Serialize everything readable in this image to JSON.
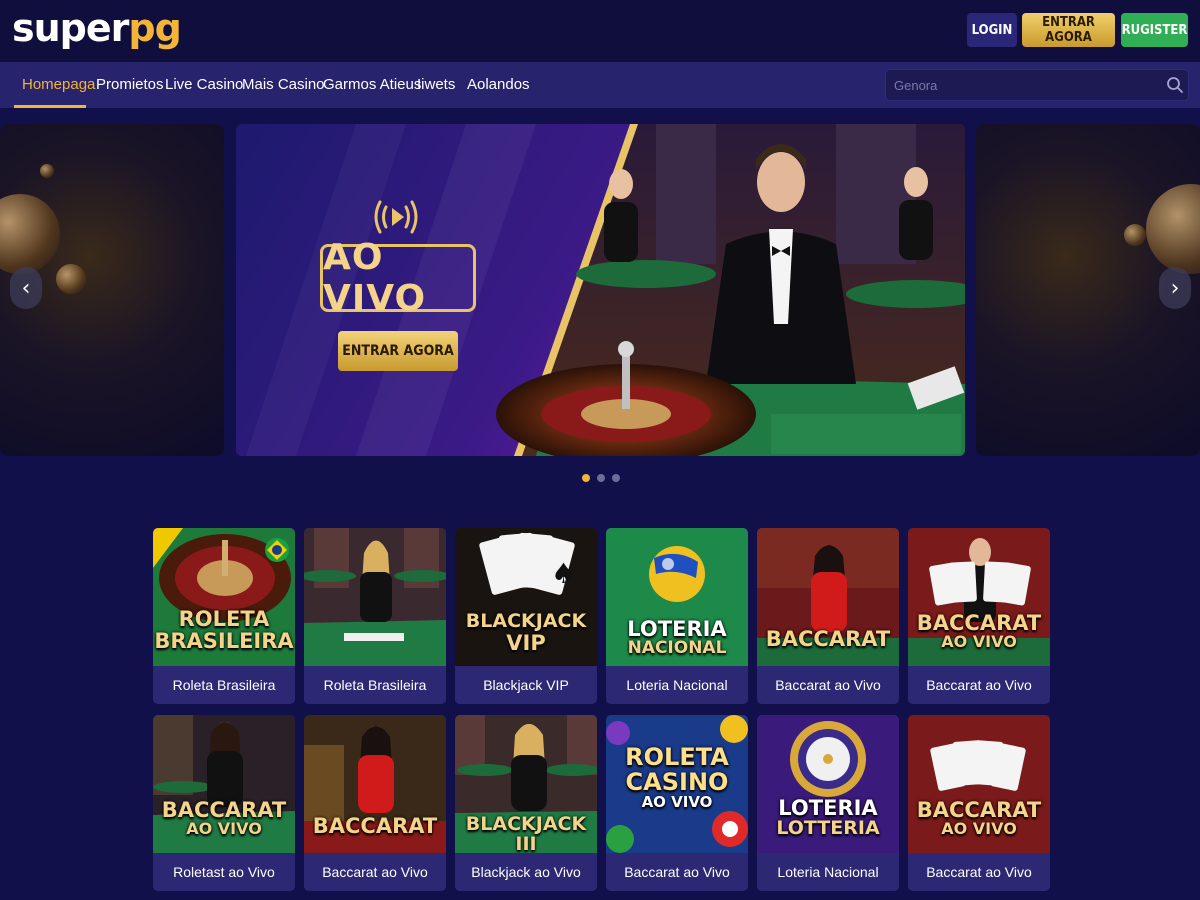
{
  "header": {
    "logo": {
      "part1": "super",
      "part2": "pg"
    },
    "login_label": "LOGIN",
    "entrar_label": "ENTRAR AGORA",
    "register_label": "RUGISTER"
  },
  "nav": {
    "items": [
      {
        "label": "Homepaga",
        "active": true
      },
      {
        "label": "Promietos"
      },
      {
        "label": "Live Casino"
      },
      {
        "label": "Mais Casino"
      },
      {
        "label": "Garmos Atieus"
      },
      {
        "label": "Iiwets"
      },
      {
        "label": "Aolandos"
      }
    ],
    "search_placeholder": "Genora"
  },
  "hero": {
    "badge": "AO VIVO",
    "cta": "ENTRAR AGORA",
    "prev_icon": "‹",
    "next_icon": "›",
    "active_dot": 0,
    "dot_count": 3
  },
  "games": [
    {
      "title1": "ROLETA",
      "title2": "BRASILEIRA",
      "label": "Roleta Brasileira",
      "theme": "green-roulette"
    },
    {
      "title1": "",
      "title2": "",
      "label": "Roleta Brasileira",
      "theme": "dealer-table"
    },
    {
      "title1": "BLACKJACK",
      "title2": "VIP",
      "label": "Blackjack VIP",
      "theme": "dark-cards"
    },
    {
      "title1": "LOTERIA",
      "title2": "NACIONAL",
      "label": "Loteria Nacional",
      "theme": "green-ball"
    },
    {
      "title1": "BACCARAT",
      "title2": "",
      "label": "Baccarat ao Vivo",
      "theme": "red-dealer"
    },
    {
      "title1": "BACCARAT",
      "title2": "AO VIVO",
      "label": "Baccarat ao Vivo",
      "theme": "red-cards-dealer"
    },
    {
      "title1": "BACCARAT",
      "title2": "AO VIVO",
      "label": "Roletast ao Vivo",
      "theme": "dealer-green"
    },
    {
      "title1": "BACCARAT",
      "title2": "",
      "label": "Baccarat ao Vivo",
      "theme": "red-dealer-2"
    },
    {
      "title1": "BLACKJACK III",
      "title2": "",
      "label": "Blackjack ao Vivo",
      "theme": "dealer-green-2"
    },
    {
      "title1": "ROLETA",
      "title2": "CASINO",
      "title3": "AO VIVO",
      "label": "Baccarat ao Vivo",
      "theme": "blue-balls"
    },
    {
      "title1": "LOTERIA",
      "title2": "LOTTERIA",
      "label": "Loteria Nacional",
      "theme": "purple-wheel"
    },
    {
      "title1": "BACCARAT",
      "title2": "AO VIVO",
      "label": "Baccarat ao Vivo",
      "theme": "red-cards"
    }
  ],
  "colors": {
    "background": "#12104a",
    "nav": "#27236d",
    "accent_gold": "#f2b53a",
    "register_green": "#2fae55",
    "card_label": "#2c2873"
  }
}
